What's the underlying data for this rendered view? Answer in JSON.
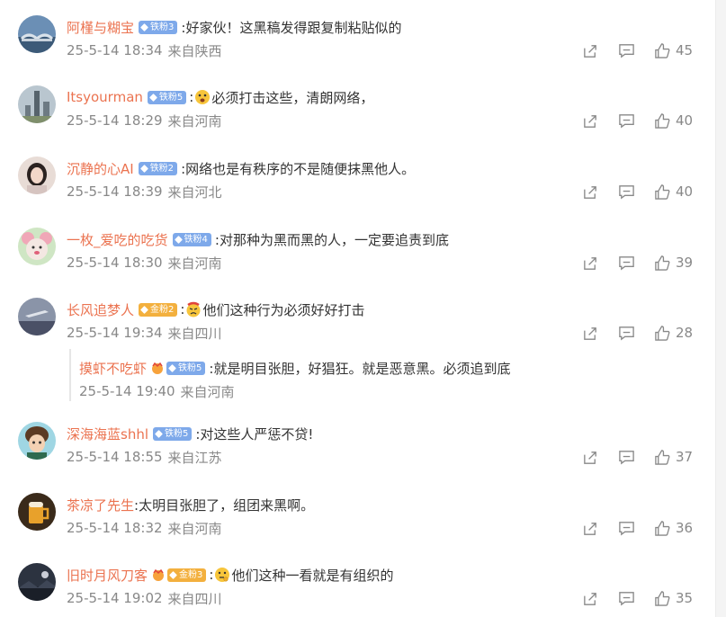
{
  "colors": {
    "username": "#eb7350",
    "text": "#333333",
    "meta": "#888888",
    "badge_blue": "#7ea9ea",
    "badge_gold": "#f3b03e"
  },
  "comments": [
    {
      "username": "阿槿与糊宝",
      "badge": "铁粉3",
      "badge_type": "iron",
      "text": ":好家伙！这黑稿发得跟复制粘贴似的",
      "time": "25-5-14 18:34",
      "location": "来自陕西",
      "likes": "45",
      "avatar": "bridge-scenery-avatar"
    },
    {
      "username": "Itsyourman",
      "badge": "铁粉5",
      "badge_type": "iron",
      "emoji": "shocked-face-emoji",
      "text": "必须打击这些，清朗网络，",
      "time": "25-5-14 18:29",
      "location": "来自河南",
      "likes": "40",
      "avatar": "city-tower-avatar"
    },
    {
      "username": "沉静的心AI",
      "badge": "铁粉2",
      "badge_type": "iron",
      "text": ":网络也是有秩序的不是随便抹黑他人。",
      "time": "25-5-14 18:39",
      "location": "来自河北",
      "likes": "40",
      "avatar": "woman-portrait-avatar"
    },
    {
      "username": "一枚_爱吃的吃货",
      "badge": "铁粉4",
      "badge_type": "iron",
      "text": ":对那种为黑而黑的人，一定要追责到底",
      "time": "25-5-14 18:30",
      "location": "来自河南",
      "likes": "39",
      "avatar": "cartoon-mouse-avatar"
    },
    {
      "username": "长风追梦人",
      "badge": "金粉2",
      "badge_type": "gold",
      "emoji": "angry-face-emoji",
      "text": "他们这种行为必须好好打击",
      "time": "25-5-14 19:34",
      "location": "来自四川",
      "likes": "28",
      "avatar": "sky-plane-avatar"
    },
    {
      "username": "深海海蓝shhl",
      "badge": "铁粉5",
      "badge_type": "iron",
      "text": ":对这些人严惩不贷!",
      "time": "25-5-14 18:55",
      "location": "来自江苏",
      "likes": "37",
      "avatar": "anime-boy-avatar"
    },
    {
      "username": "茶凉了先生",
      "badge": "",
      "badge_type": "none",
      "text": ":太明目张胆了，组团来黑啊。",
      "time": "25-5-14 18:32",
      "location": "来自河南",
      "likes": "36",
      "avatar": "beer-mug-avatar"
    },
    {
      "username": "旧时月风刀客",
      "badge": "金粉3",
      "badge_type": "gold",
      "emoji": "thinking-face-emoji",
      "text": "他们这种一看就是有组织的",
      "time": "25-5-14 19:02",
      "location": "来自四川",
      "likes": "35",
      "avatar": "dark-landscape-avatar"
    }
  ],
  "reply": {
    "username": "摸虾不吃虾",
    "badge": "铁粉5",
    "badge_type": "iron",
    "text": ":就是明目张胆，好猖狂。就是恶意黑。必须追到底",
    "time": "25-5-14 19:40",
    "location": "来自河南"
  }
}
